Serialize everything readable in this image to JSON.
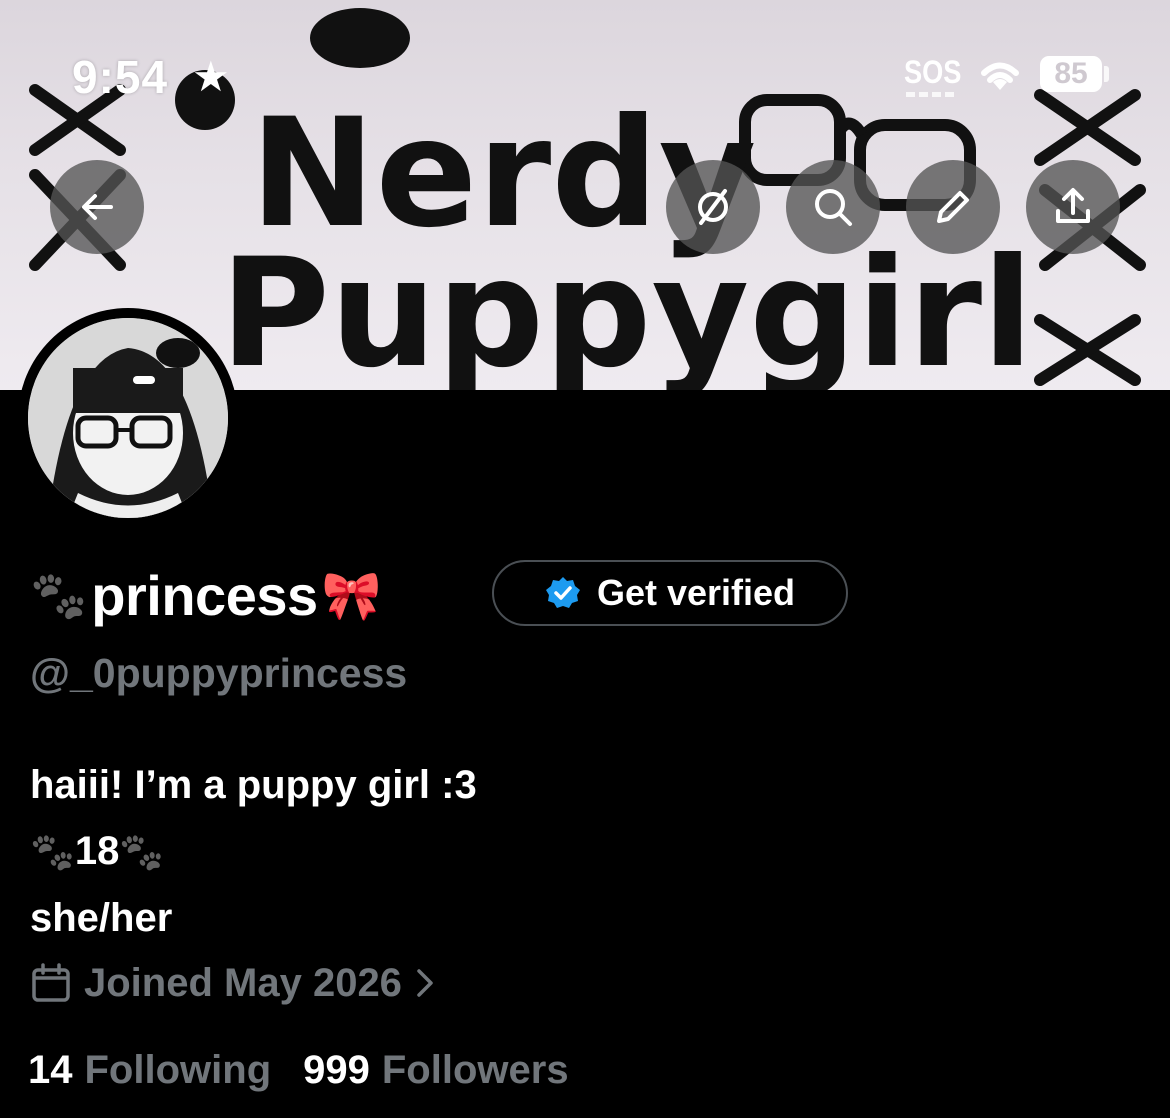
{
  "status_bar": {
    "time": "9:54",
    "focus_star": "★",
    "sos": "SOS",
    "battery": "85"
  },
  "banner": {
    "title_line1": "Nerdy",
    "title_line2": "Puppygirl",
    "decor_icons": [
      "paw-print-icon",
      "glasses-icon",
      "x-mark-icon"
    ]
  },
  "toolbar": {
    "back": "back-arrow-icon",
    "grok": "grok-slash-icon",
    "search": "search-icon",
    "edit": "pencil-icon",
    "share": "share-icon"
  },
  "profile": {
    "name_prefix": "🐾",
    "display_name": "princess",
    "name_suffix": "🎀",
    "verify_button": "Get verified",
    "handle": "@_0puppyprincess",
    "bio_line1": "haiii! I’m a puppy girl :3",
    "bio_line2_left": "🐾",
    "bio_line2_number": "18",
    "bio_line2_right": "🐾",
    "bio_line3": "she/her",
    "joined": "Joined May 2026",
    "following_count": "14",
    "following_label": "Following",
    "followers_count": "999",
    "followers_label": "Followers"
  },
  "colors": {
    "background": "#000000",
    "muted_text": "#71767b",
    "verified_blue": "#1d9bf0",
    "button_border": "#4a4f54"
  }
}
